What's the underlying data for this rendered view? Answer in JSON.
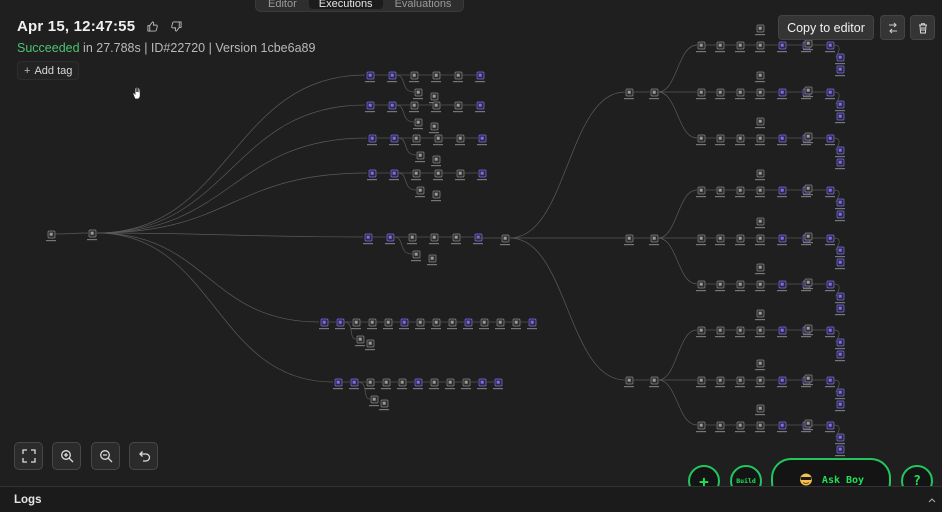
{
  "tabs": [
    {
      "label": "Editor"
    },
    {
      "label": "Executions"
    },
    {
      "label": "Evaluations"
    }
  ],
  "execution": {
    "title": "Apr 15, 12:47:55",
    "status": "Succeeded",
    "duration": " in 27.788s",
    "id_text": " | ID#22720 | ",
    "version_text": "Version 1cbe6a89"
  },
  "actions": {
    "add_tag": "Add tag",
    "copy_to_editor": "Copy to editor"
  },
  "assistant": {
    "plus": "+",
    "build": "Build",
    "ask": "Ask Boy",
    "help": "?"
  },
  "logs": {
    "label": "Logs"
  },
  "colors": {
    "background": "#1f1f1f",
    "success": "#4bc46e",
    "accent_green": "#22c55e",
    "node_purple": "#7b6cff"
  }
}
